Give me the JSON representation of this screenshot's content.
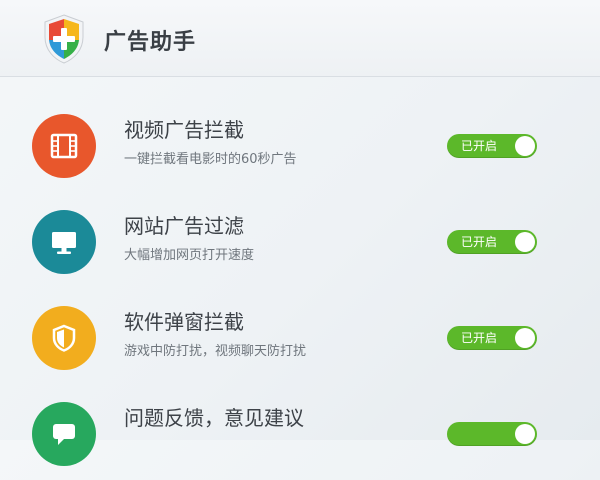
{
  "app": {
    "title": "广告助手",
    "logo_icon": "shield-plus-icon"
  },
  "features": [
    {
      "icon": "film-icon",
      "icon_color": "#e8572c",
      "title": "视频广告拦截",
      "description": "一键拦截看电影时的60秒广告",
      "toggle_label": "已开启",
      "enabled": true
    },
    {
      "icon": "monitor-icon",
      "icon_color": "#1b8a98",
      "title": "网站广告过滤",
      "description": "大幅增加网页打开速度",
      "toggle_label": "已开启",
      "enabled": true
    },
    {
      "icon": "shield-icon",
      "icon_color": "#f2ad1e",
      "title": "软件弹窗拦截",
      "description": "游戏中防打扰，视频聊天防打扰",
      "toggle_label": "已开启",
      "enabled": true
    },
    {
      "icon": "feedback-icon",
      "icon_color": "#27a85e",
      "title": "问题反馈，意见建议",
      "description": "",
      "toggle_label": "",
      "enabled": true
    }
  ],
  "toggle_color": "#5cb82a"
}
